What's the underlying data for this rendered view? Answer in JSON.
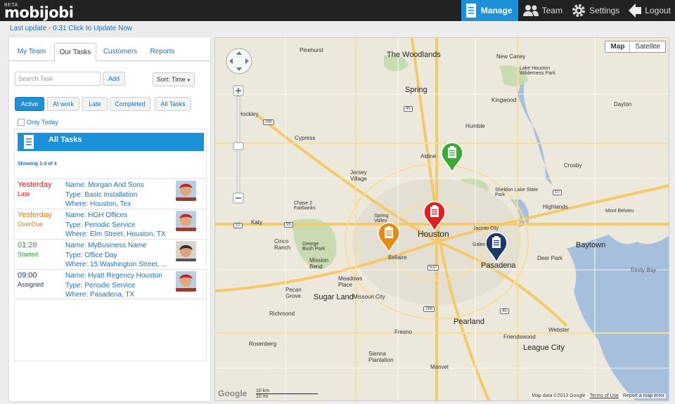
{
  "app": {
    "beta": "BETA",
    "name": "mobijobi"
  },
  "nav": [
    {
      "label": "Manage",
      "icon": "document-icon",
      "active": true
    },
    {
      "label": "Team",
      "icon": "team-icon",
      "active": false
    },
    {
      "label": "Settings",
      "icon": "gear-icon",
      "active": false
    },
    {
      "label": "Logout",
      "icon": "logout-arrow-icon",
      "active": false
    }
  ],
  "last_update": "Last update - 0:31 Click to Update Now",
  "tabs": [
    "My Team",
    "Our Tasks",
    "Customers",
    "Reports"
  ],
  "active_tab": "Our Tasks",
  "search": {
    "placeholder": "Search Task",
    "value": ""
  },
  "buttons": {
    "add": "Add",
    "sort": "Sort: Time"
  },
  "filters": [
    "Active",
    "At work",
    "Late",
    "Completed",
    "All Tasks"
  ],
  "active_filter": "Active",
  "only_today": "Only Today",
  "list": {
    "title": "All Tasks",
    "showing": "Showing 1-4 of 4",
    "tasks": [
      {
        "when": "Yesterday",
        "status": "Late",
        "color": "#d0201e",
        "name": "Name: Morgan And Sons",
        "type": "Type: Basic Installation",
        "where": "Where: Houston, Tex"
      },
      {
        "when": "Yesterday",
        "status": "OverDue",
        "color": "#e07a10",
        "name": "Name: HGH Offices",
        "type": "Type: Periodic Service",
        "where": "Where: Elm Street, Houston, TX"
      },
      {
        "when": "01:28",
        "status": "Started",
        "color": "#2aa02a",
        "name": "Name: MyBusiness Name",
        "type": "Type: Office Day",
        "where": "Where: 15 Washington Street, ..."
      },
      {
        "when": "09:00",
        "status": "Assigned",
        "color": "#1b2f5c",
        "name": "Name: Hyatt Regency Houston",
        "type": "Type: Periodic Service",
        "where": "Where: Pasadena, TX"
      }
    ]
  },
  "map": {
    "type_buttons": [
      "Map",
      "Satellite"
    ],
    "active_type": "Map",
    "attribution": "Map data ©2013 Google -",
    "terms": "Terms of Use",
    "report": "Report a map error",
    "logo": "Google",
    "scale_km": "10 km",
    "scale_mi": "10 mi",
    "places": [
      "Pinehurst",
      "The Woodlands",
      "New Caney",
      "Lake Houston Wilderness Park",
      "Spring",
      "Kingwood",
      "Hockley",
      "Cypress",
      "Humble",
      "Dayton",
      "Aldine",
      "Crosby",
      "Jersey Village",
      "Sheldon Lake State Park",
      "Highlands",
      "Chase 2 Fairbanks",
      "Katy",
      "Spring Valley",
      "Houston",
      "Jacinto City",
      "Galena Park",
      "Baytown",
      "Cinco Ranch",
      "George Bush Park",
      "Mission Bend",
      "Bellaire",
      "Pasadena",
      "Deer Park",
      "Meadows Place",
      "Pecan Grove",
      "Sugar Land",
      "Missouri City",
      "Richmond",
      "Pearland",
      "Rosenberg",
      "Fresno",
      "Webster",
      "Friendswood",
      "League City",
      "Sienna Plantation",
      "Manvel",
      "Trinity Bay",
      "Mont Belvieu"
    ],
    "markers": [
      {
        "icon": "clipboard-marker-icon",
        "color": "#3aaa35",
        "task": "Started"
      },
      {
        "icon": "clipboard-marker-icon",
        "color": "#e02020",
        "task": "Late"
      },
      {
        "icon": "clipboard-marker-icon",
        "color": "#e68a12",
        "task": "OverDue"
      },
      {
        "icon": "clipboard-marker-icon",
        "color": "#1b3a6b",
        "task": "Assigned"
      }
    ]
  }
}
